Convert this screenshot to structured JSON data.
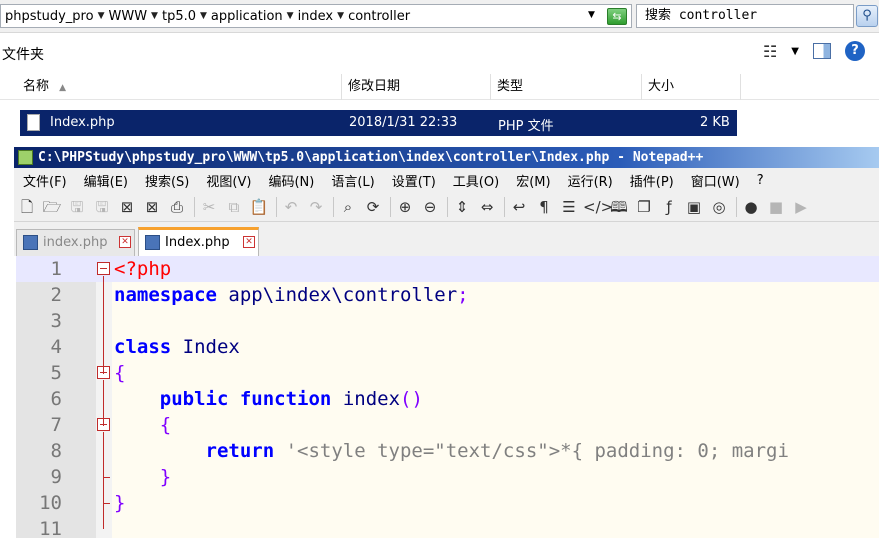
{
  "explorer": {
    "breadcrumbs": [
      "phpstudy_pro",
      "WWW",
      "tp5.0",
      "application",
      "index",
      "controller"
    ],
    "search_placeholder": "搜索 controller",
    "folder_label": "文件夹",
    "columns": [
      "名称",
      "修改日期",
      "类型",
      "大小"
    ],
    "files": [
      {
        "name": "Index.php",
        "modified": "2018/1/31 22:33",
        "type": "PHP 文件",
        "size": "2 KB"
      }
    ]
  },
  "notepad": {
    "title": "C:\\PHPStudy\\phpstudy_pro\\WWW\\tp5.0\\application\\index\\controller\\Index.php - Notepad++",
    "menu": [
      "文件(F)",
      "编辑(E)",
      "搜索(S)",
      "视图(V)",
      "编码(N)",
      "语言(L)",
      "设置(T)",
      "工具(O)",
      "宏(M)",
      "运行(R)",
      "插件(P)",
      "窗口(W)",
      "?"
    ],
    "tabs": [
      {
        "label": "index.php",
        "active": false
      },
      {
        "label": "Index.php",
        "active": true
      }
    ],
    "code_lines": [
      {
        "num": "1",
        "tokens": [
          {
            "t": "<?php",
            "c": "php-tag"
          }
        ]
      },
      {
        "num": "2",
        "tokens": [
          {
            "t": "namespace",
            "c": "kw"
          },
          {
            "t": " app\\index\\controller",
            "c": "plain"
          },
          {
            "t": ";",
            "c": "br"
          }
        ]
      },
      {
        "num": "3",
        "tokens": []
      },
      {
        "num": "4",
        "tokens": [
          {
            "t": "class",
            "c": "kw"
          },
          {
            "t": " Index",
            "c": "plain"
          }
        ]
      },
      {
        "num": "5",
        "tokens": [
          {
            "t": "{",
            "c": "br"
          }
        ]
      },
      {
        "num": "6",
        "tokens": [
          {
            "t": "    ",
            "c": "plain"
          },
          {
            "t": "public",
            "c": "kw"
          },
          {
            "t": " ",
            "c": "plain"
          },
          {
            "t": "function",
            "c": "kw"
          },
          {
            "t": " index",
            "c": "plain"
          },
          {
            "t": "()",
            "c": "br"
          }
        ]
      },
      {
        "num": "7",
        "tokens": [
          {
            "t": "    {",
            "c": "br"
          }
        ]
      },
      {
        "num": "8",
        "tokens": [
          {
            "t": "        ",
            "c": "plain"
          },
          {
            "t": "return",
            "c": "kw"
          },
          {
            "t": " '<style type=\"text/css\">*{ padding: 0; margi",
            "c": "str"
          }
        ]
      },
      {
        "num": "9",
        "tokens": [
          {
            "t": "    }",
            "c": "br"
          }
        ]
      },
      {
        "num": "10",
        "tokens": [
          {
            "t": "}",
            "c": "br"
          }
        ]
      },
      {
        "num": "11",
        "tokens": []
      }
    ]
  },
  "colors": {
    "selection": "#0a246a",
    "keyword": "#0000ff",
    "php_tag": "#ff0000",
    "bracket": "#8000ff",
    "string": "#808080",
    "tab_accent": "#f7a12e"
  }
}
